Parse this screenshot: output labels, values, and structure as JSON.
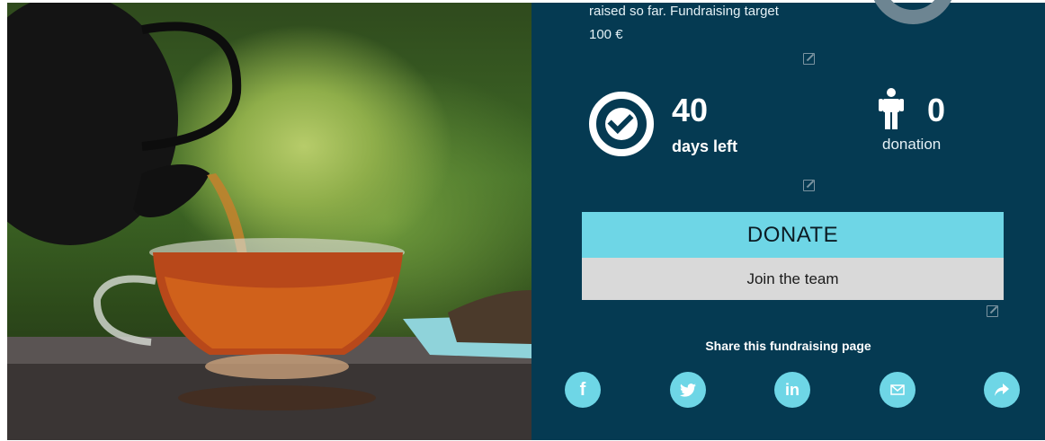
{
  "campaign": {
    "raised_text": "raised so far. Fundraising target 100 €",
    "days_left_value": "40",
    "days_left_label": "days left",
    "donation_count": "0",
    "donation_label": "donation"
  },
  "actions": {
    "donate_label": "DONATE",
    "join_label": "Join the team"
  },
  "share": {
    "title": "Share this fundraising page",
    "icons": [
      "facebook-icon",
      "twitter-icon",
      "linkedin-icon",
      "email-icon",
      "share-icon"
    ]
  },
  "colors": {
    "panel_bg": "#053a52",
    "accent": "#6ed6e6",
    "join_bg": "#d9d9d9"
  }
}
